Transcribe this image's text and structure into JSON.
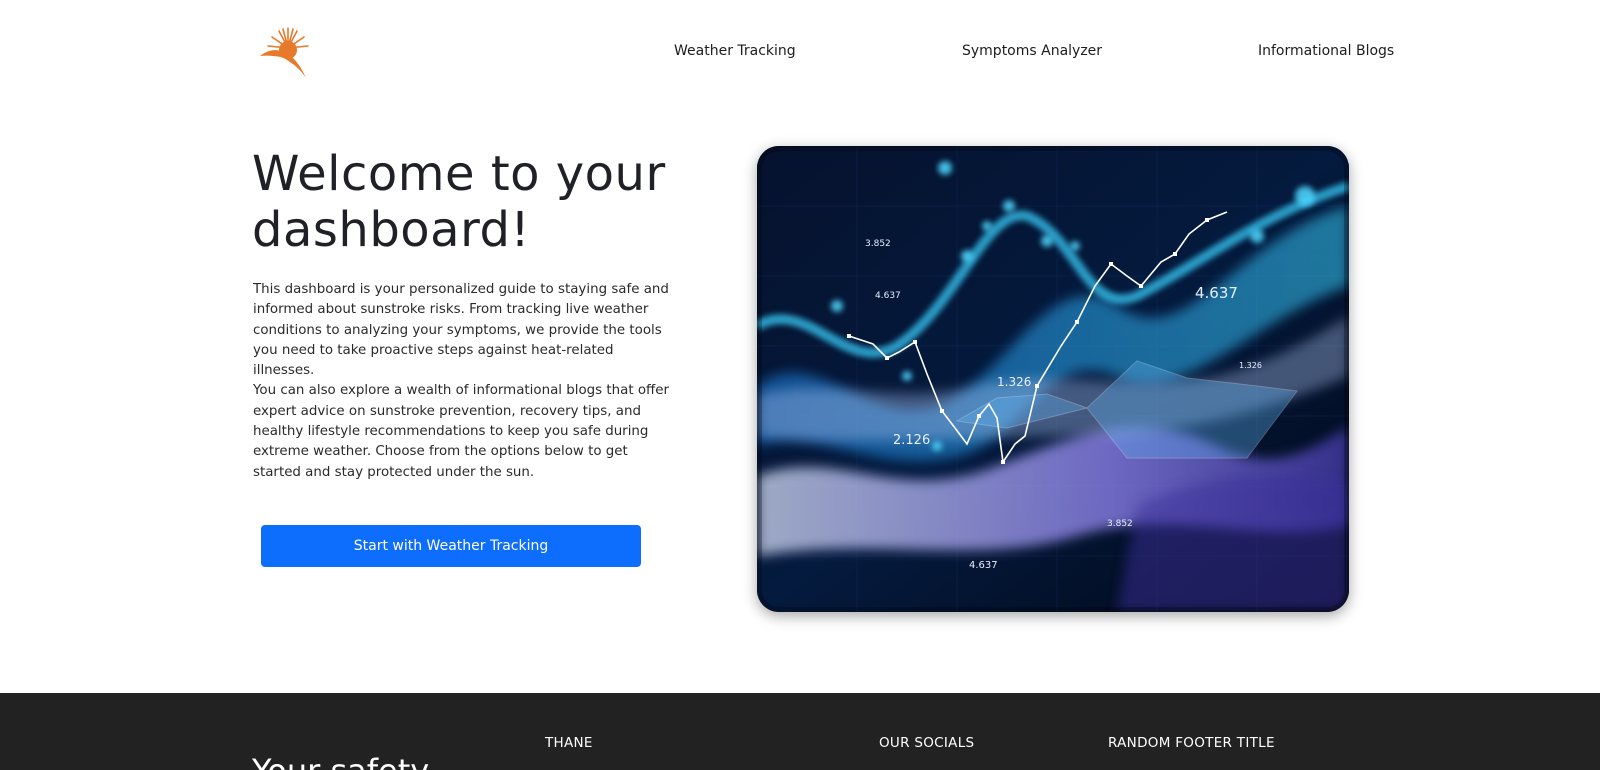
{
  "header": {
    "logo_icon": "sun-icon",
    "nav": [
      {
        "label": "Weather Tracking"
      },
      {
        "label": "Symptoms Analyzer"
      },
      {
        "label": "Informational Blogs"
      }
    ]
  },
  "hero": {
    "title": "Welcome to your dashboard!",
    "paragraph_1": "This dashboard is your personalized guide to staying safe and informed about sunstroke risks. From tracking live weather conditions to analyzing your symptoms, we provide the tools you need to take proactive steps against heat-related illnesses.",
    "paragraph_2": "You can also explore a wealth of informational blogs that offer expert advice on sunstroke prevention, recovery tips, and healthy lifestyle recommendations to keep you safe during extreme weather. Choose from the options below to get started and stay protected under the sun.",
    "cta_label": "Start with Weather Tracking",
    "image_labels": [
      "4.637",
      "3.852",
      "1.326",
      "2.126",
      "4.637",
      "3.852",
      "1.326",
      "4.637"
    ]
  },
  "footer": {
    "tagline": "Your safety",
    "columns": [
      {
        "title": "THANE"
      },
      {
        "title": "OUR SOCIALS"
      },
      {
        "title": "RANDOM FOOTER TITLE"
      }
    ]
  },
  "colors": {
    "accent": "#0d6efd",
    "logo": "#e8782a",
    "footer_bg": "#222222"
  }
}
